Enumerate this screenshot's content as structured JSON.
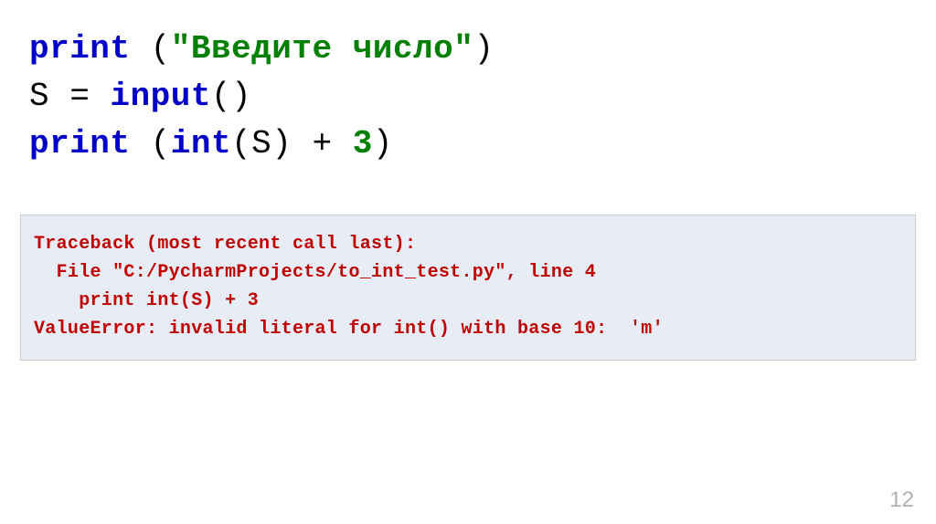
{
  "code": {
    "line1_kw": "print",
    "line1_plain1": " (",
    "line1_str": "\"Введите число\"",
    "line1_plain2": ")",
    "line2_plain1": "S = ",
    "line2_kw": "input",
    "line2_plain2": "()",
    "line3_kw1": "print",
    "line3_plain1": " (",
    "line3_kw2": "int",
    "line3_plain2": "(S) + ",
    "line3_num": "3",
    "line3_plain3": ")"
  },
  "traceback": {
    "line1": "Traceback (most recent call last):",
    "line2": "  File \"C:/PycharmProjects/to_int_test.py\", line 4",
    "line3": "    print int(S) + 3",
    "line4": "ValueError: invalid literal for int() with base 10:  'm'"
  },
  "page_number": "12"
}
